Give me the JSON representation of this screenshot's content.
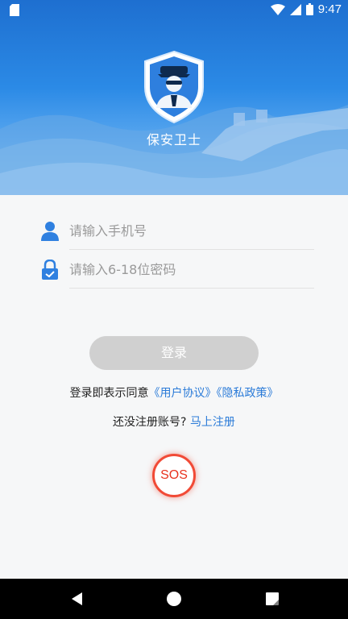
{
  "status_bar": {
    "time": "9:47"
  },
  "header": {
    "app_name": "保安卫士"
  },
  "form": {
    "phone_placeholder": "请输入手机号",
    "password_placeholder": "请输入6-18位密码",
    "login_label": "登录"
  },
  "agreement": {
    "prefix": "登录即表示同意",
    "user_agreement": "《用户协议》",
    "privacy_policy": "《隐私政策》"
  },
  "register": {
    "prompt": "还没注册账号?",
    "link": "马上注册"
  },
  "sos": {
    "label": "SOS"
  },
  "colors": {
    "accent": "#2b7bd8",
    "sos": "#f14a36",
    "header": "#2b8ae6",
    "button_disabled": "#d0d0d0"
  },
  "icons": [
    "sd-card-icon",
    "wifi-icon",
    "signal-icon",
    "battery-icon",
    "guard-shield-logo",
    "user-icon",
    "lock-icon",
    "back-icon",
    "home-icon",
    "recents-icon"
  ]
}
